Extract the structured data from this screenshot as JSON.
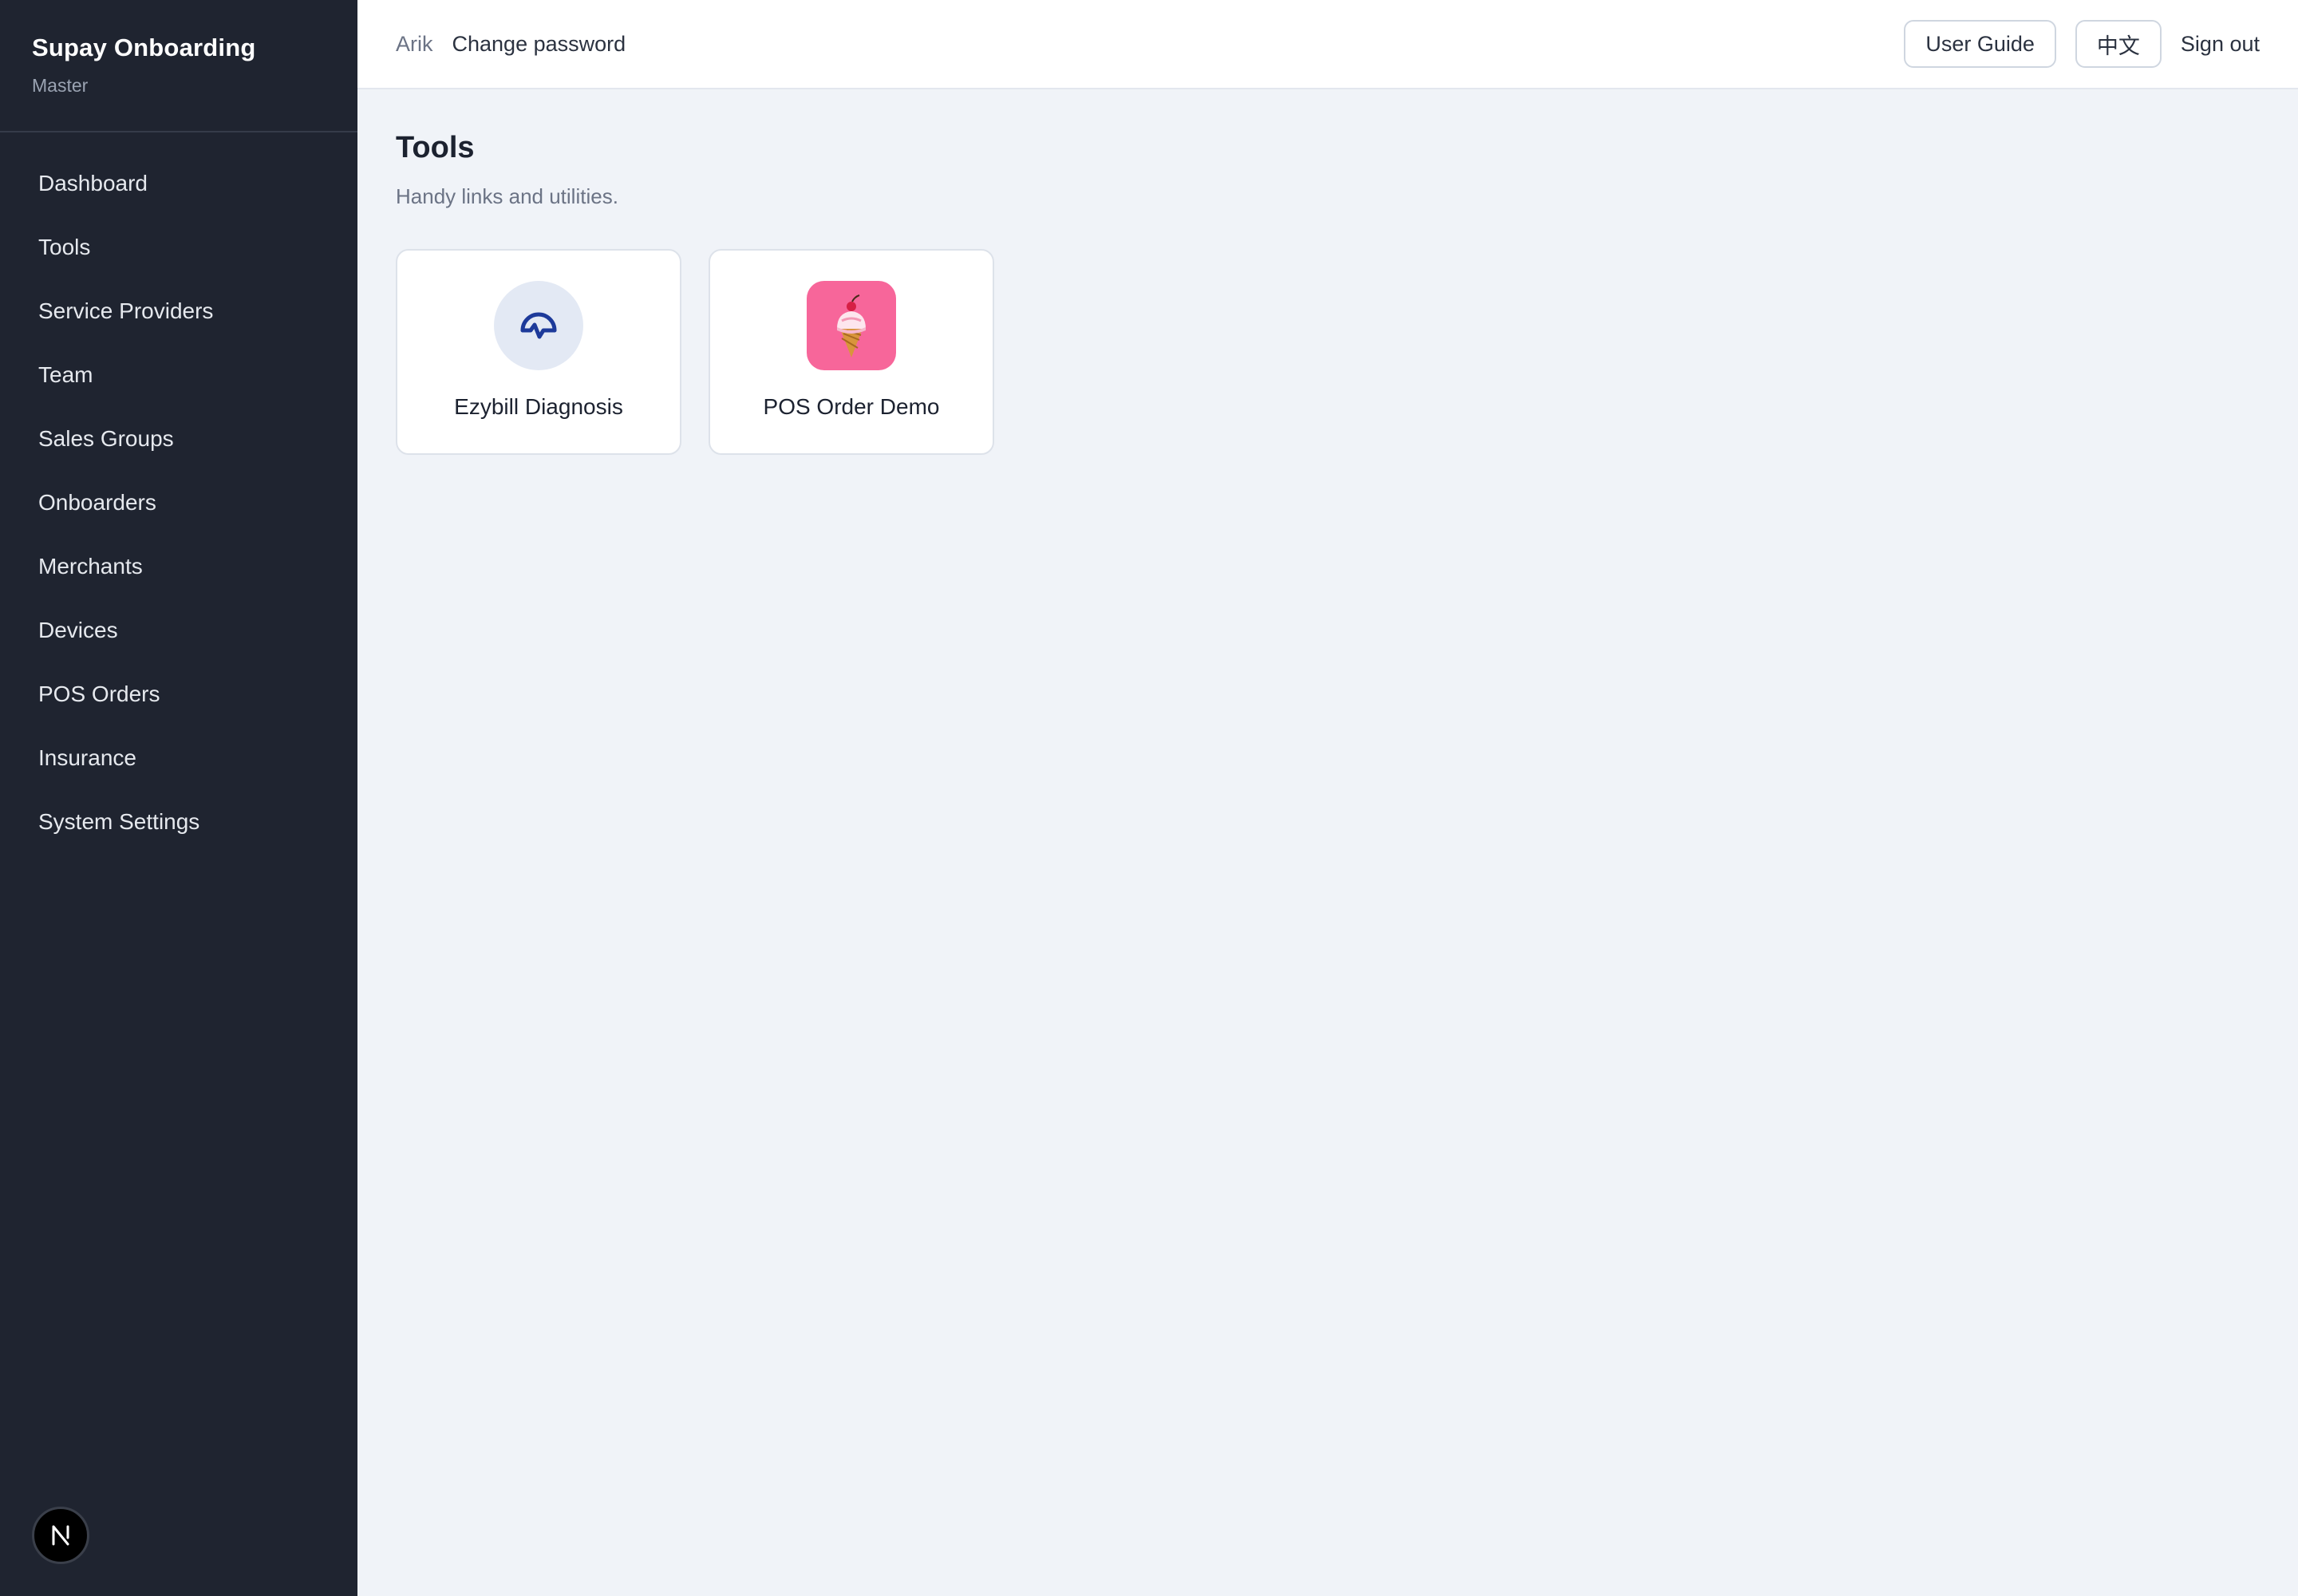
{
  "brand": {
    "title": "Supay Onboarding",
    "subtitle": "Master"
  },
  "sidebar": {
    "items": [
      {
        "label": "Dashboard"
      },
      {
        "label": "Tools"
      },
      {
        "label": "Service Providers"
      },
      {
        "label": "Team"
      },
      {
        "label": "Sales Groups"
      },
      {
        "label": "Onboarders"
      },
      {
        "label": "Merchants"
      },
      {
        "label": "Devices"
      },
      {
        "label": "POS Orders"
      },
      {
        "label": "Insurance"
      },
      {
        "label": "System Settings"
      }
    ],
    "badge_icon": "n-logo-icon"
  },
  "header": {
    "user": "Arik",
    "change_password": "Change password",
    "user_guide": "User Guide",
    "language": "中文",
    "sign_out": "Sign out"
  },
  "page": {
    "title": "Tools",
    "subtitle": "Handy links and utilities."
  },
  "tools": [
    {
      "label": "Ezybill Diagnosis",
      "icon": "diagnosis-pulse-icon",
      "icon_bg": "#e3e9f4",
      "icon_color": "#1d3a9a"
    },
    {
      "label": "POS Order Demo",
      "icon": "ice-cream-icon",
      "icon_bg": "#f7669a"
    }
  ]
}
